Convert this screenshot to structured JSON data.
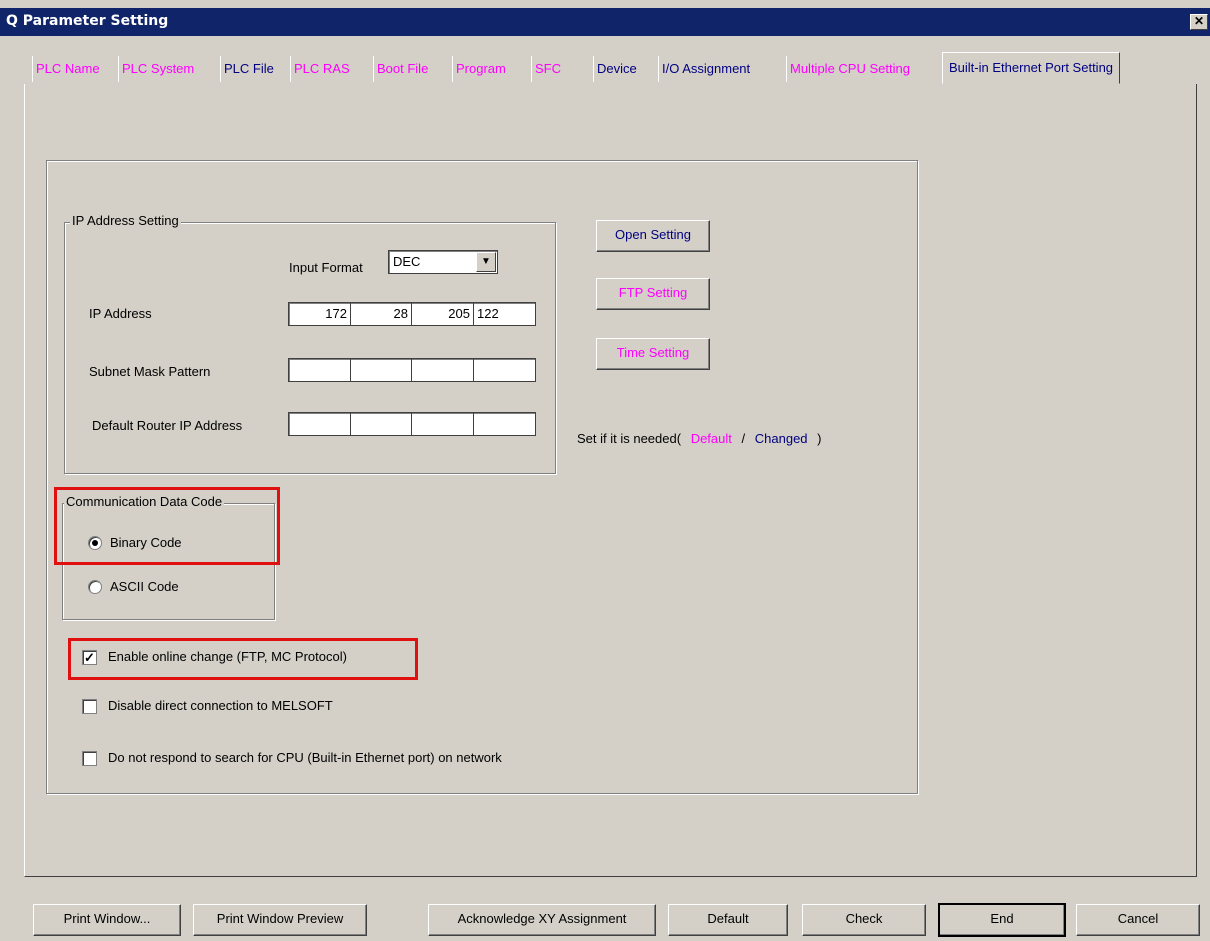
{
  "window": {
    "title": "Q Parameter Setting",
    "close_glyph": "✕"
  },
  "tabs": [
    {
      "label": "PLC Name",
      "color": "pink"
    },
    {
      "label": "PLC System",
      "color": "pink"
    },
    {
      "label": "PLC File",
      "color": "navy"
    },
    {
      "label": "PLC RAS",
      "color": "pink"
    },
    {
      "label": "Boot File",
      "color": "pink"
    },
    {
      "label": "Program",
      "color": "pink"
    },
    {
      "label": "SFC",
      "color": "pink"
    },
    {
      "label": "Device",
      "color": "navy"
    },
    {
      "label": "I/O Assignment",
      "color": "navy"
    },
    {
      "label": "Multiple CPU Setting",
      "color": "pink"
    },
    {
      "label": "Built-in Ethernet Port Setting",
      "color": "navy",
      "active": true
    }
  ],
  "ip_setting": {
    "legend": "IP Address Setting",
    "input_format_label": "Input Format",
    "input_format_value": "DEC",
    "ip_label": "IP Address",
    "ip_octets": [
      "172",
      "28",
      "205",
      "122"
    ],
    "subnet_label": "Subnet Mask Pattern",
    "subnet_octets": [
      "",
      "",
      "",
      ""
    ],
    "router_label": "Default Router IP Address",
    "router_octets": [
      "",
      "",
      "",
      ""
    ]
  },
  "side_buttons": {
    "open_setting": "Open Setting",
    "ftp_setting": "FTP Setting",
    "time_setting": "Time Setting"
  },
  "note": {
    "prefix": "Set if it is needed(",
    "default": "Default",
    "slash": "/",
    "changed": "Changed",
    "suffix": ")"
  },
  "comm_code": {
    "legend": "Communication Data Code",
    "binary": "Binary Code",
    "ascii": "ASCII Code",
    "selected": "binary"
  },
  "options": {
    "online_change": {
      "label": "Enable online change (FTP, MC Protocol)",
      "checked": true,
      "mark": "✓"
    },
    "disable_direct": {
      "label": "Disable direct connection to MELSOFT",
      "checked": false
    },
    "no_respond": {
      "label": "Do not respond to search for CPU (Built-in Ethernet port) on network",
      "checked": false
    }
  },
  "bottom_buttons": {
    "print_window": "Print Window...",
    "print_preview": "Print Window Preview",
    "acknowledge_xy": "Acknowledge XY Assignment",
    "default": "Default",
    "check": "Check",
    "end": "End",
    "cancel": "Cancel"
  },
  "colors": {
    "pink": "#ff00ff",
    "navy": "#000080",
    "highlight": "#e01010",
    "titlebar": "#10246a"
  }
}
